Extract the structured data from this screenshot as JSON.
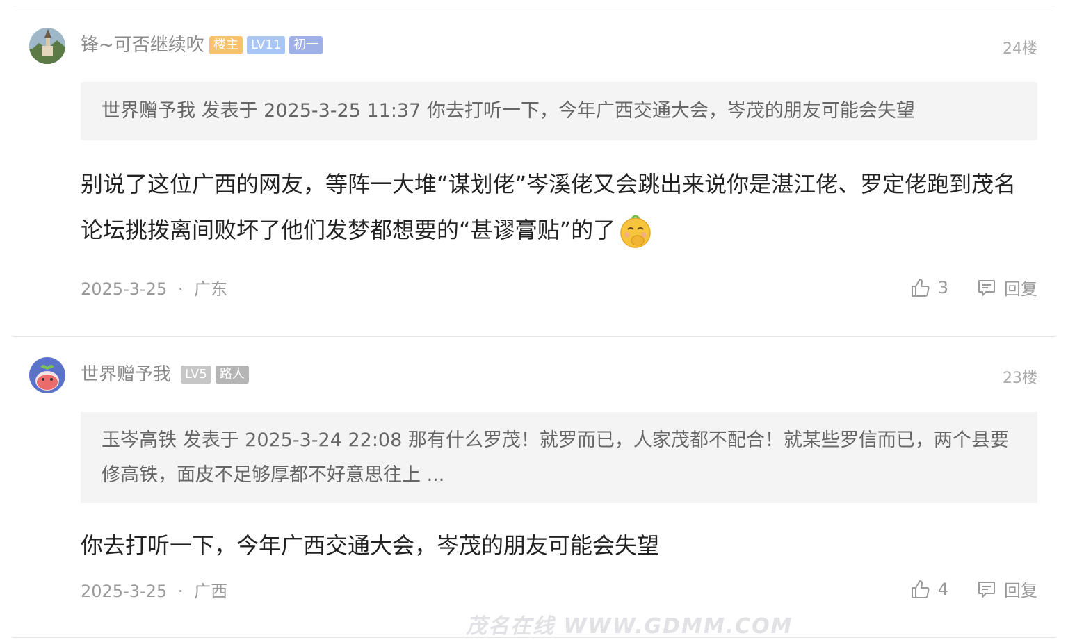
{
  "posts": [
    {
      "username": "锋~可否继续吹",
      "badges": [
        {
          "label": "楼主",
          "color": "#f5c36b"
        },
        {
          "label": "LV11",
          "color": "#a9c6f5"
        },
        {
          "label": "初一",
          "color": "#9fb0e6"
        }
      ],
      "floor": "24楼",
      "quote": "世界赠予我 发表于 2025-3-25 11:37 你去打听一下，今年广西交通大会，岑茂的朋友可能会失望",
      "content": "别说了这位广西的网友，等阵一大堆“谋划佬”岑溪佬又会跳出来说你是湛江佬、罗定佬跑到茂名论坛挑拨离间败坏了他们发梦都想要的“甚谬膏贴”的了",
      "content_emoji": "shushing-face-emoji",
      "date": "2025-3-25",
      "location": "广东",
      "likes": "3",
      "reply_label": "回复"
    },
    {
      "username": "世界赠予我",
      "badges": [
        {
          "label": "LV5",
          "color": "#c6c6c6"
        },
        {
          "label": "路人",
          "color": "#b5b5b5"
        }
      ],
      "floor": "23楼",
      "quote": "玉岑高铁 发表于 2025-3-24 22:08 那有什么罗茂！就罗而已，人家茂都不配合！就某些罗信而已，两个县要修高铁，面皮不足够厚都不好意思往上 ...",
      "content": "你去打听一下，今年广西交通大会，岑茂的朋友可能会失望",
      "date": "2025-3-25",
      "location": "广西",
      "likes": "4",
      "reply_label": "回复"
    }
  ],
  "separator": "·",
  "watermark": "茂名在线 WWW.GDMM.COM"
}
